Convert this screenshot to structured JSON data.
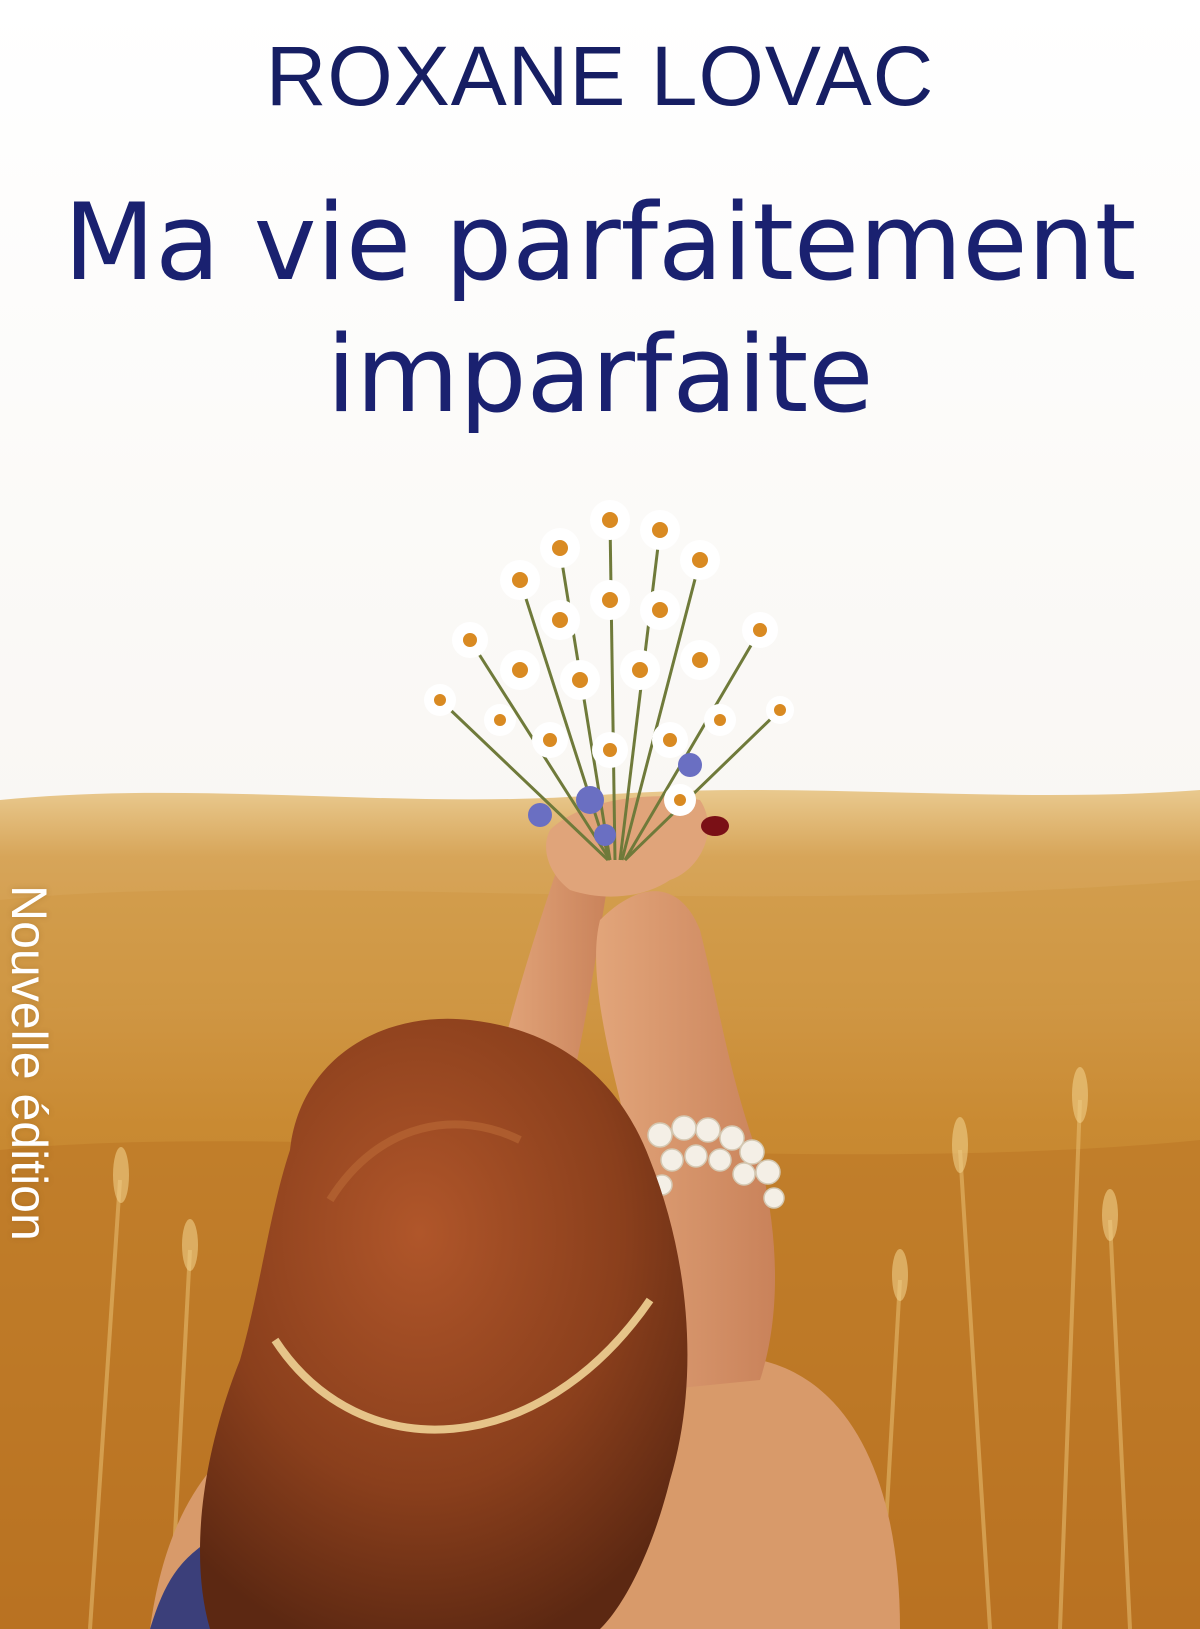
{
  "cover": {
    "author": "ROXANE LOVAC",
    "title_line1": "Ma vie parfaitement",
    "title_line2": "imparfaite",
    "edition": "Nouvelle édition"
  },
  "colors": {
    "title": "#1a2170",
    "author": "#161e63",
    "edition": "#ffffff",
    "sky": "#fbfaf8",
    "field": "#c98a32",
    "hair": "#8a3f1c"
  },
  "icons": [
    "chamomile-bouquet-illustration",
    "wheat-field-illustration",
    "woman-raising-hands-illustration"
  ]
}
